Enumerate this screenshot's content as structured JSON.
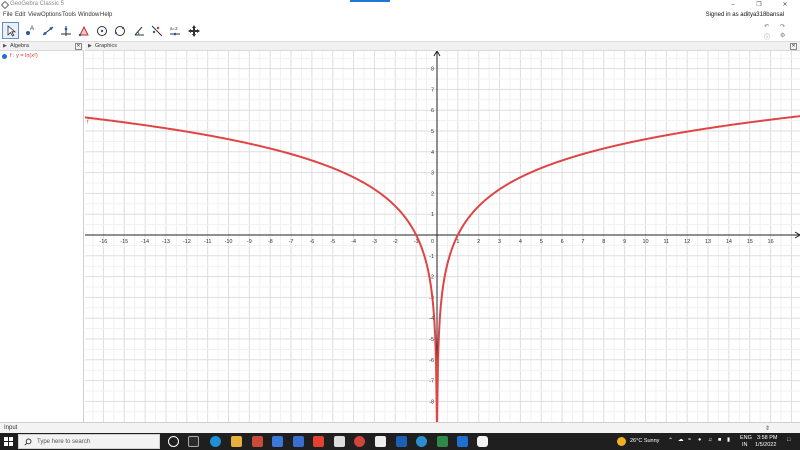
{
  "window": {
    "title": "GeoGebra Classic 5"
  },
  "menu": [
    "File",
    "Edit",
    "View",
    "Options",
    "Tools",
    "Window",
    "Help"
  ],
  "account": {
    "signed_in": "Signed in as aditya318bansal"
  },
  "toolbar": {
    "tools": [
      "move-tool",
      "point-tool",
      "line-tool",
      "perpendicular-tool",
      "polygon-tool",
      "circle-tool",
      "circle-three-points-tool",
      "angle-tool",
      "reflect-tool",
      "slider-tool",
      "move-graphics-tool"
    ],
    "slider_label": "a=2"
  },
  "algebra": {
    "title": "Algebra",
    "entry": "f : y = ln(x²)"
  },
  "graphics": {
    "title": "Graphics",
    "function_label": "f",
    "curve_color": "#e04545",
    "x_ticks": [
      -16,
      -15,
      -14,
      -13,
      -12,
      -11,
      -10,
      -9,
      -8,
      -7,
      -6,
      -5,
      -4,
      -3,
      -2,
      -1,
      0,
      1,
      2,
      3,
      4,
      5,
      6,
      7,
      8,
      9,
      10,
      11,
      12,
      13,
      14,
      15,
      16
    ],
    "y_ticks": [
      -8,
      -7,
      -6,
      -5,
      -4,
      -3,
      -2,
      -1,
      1,
      2,
      3,
      4,
      5,
      6,
      7,
      8
    ]
  },
  "input": {
    "label": "Input"
  },
  "taskbar": {
    "search_placeholder": "Type here to search",
    "weather": "26°C  Sunny",
    "lang_top": "ENG",
    "lang_bottom": "IN",
    "time": "3:58 PM",
    "date": "1/5/2022"
  }
}
